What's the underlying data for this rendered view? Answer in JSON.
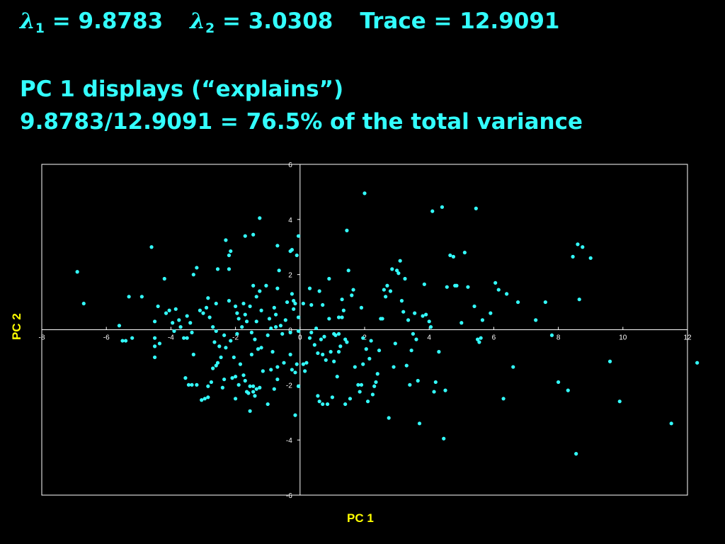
{
  "header": {
    "lambda_symbol": "λ",
    "lambda1_sub": "1",
    "lambda1_value": "= 9.8783",
    "lambda2_sub": "2",
    "lambda2_value": "= 3.0308",
    "trace": "Trace = 12.9091",
    "explain_line1": "PC 1 displays (“explains”)",
    "explain_line2": "9.8783/12.9091 = 76.5% of the total variance"
  },
  "colors": {
    "background": "#000000",
    "text": "#33ffff",
    "axis_title": "#ffff00",
    "points": "#33ffff",
    "plot_bg": "#ffffff"
  },
  "chart_data": {
    "type": "scatter",
    "title": "",
    "xlabel": "PC 1",
    "ylabel": "PC 2",
    "xlim": [
      -8,
      12
    ],
    "ylim": [
      -6,
      6
    ],
    "xticks": [
      -8,
      -6,
      -4,
      -2,
      0,
      2,
      4,
      6,
      8,
      10,
      12
    ],
    "yticks": [
      -6,
      -4,
      -2,
      0,
      2,
      4,
      6
    ],
    "grid": false,
    "series": [
      {
        "points": [
          [
            -6.9,
            2.1
          ],
          [
            -6.7,
            0.95
          ],
          [
            -5.6,
            0.15
          ],
          [
            -5.5,
            -0.4
          ],
          [
            -5.3,
            1.2
          ],
          [
            -5.2,
            -0.3
          ],
          [
            -5.4,
            -0.4
          ],
          [
            -4.9,
            1.2
          ],
          [
            -4.6,
            3.0
          ],
          [
            -4.5,
            0.3
          ],
          [
            -4.4,
            0.85
          ],
          [
            -4.5,
            -0.3
          ],
          [
            -4.5,
            -0.6
          ],
          [
            -4.5,
            -1.0
          ],
          [
            -4.35,
            -0.5
          ],
          [
            -4.2,
            1.85
          ],
          [
            -4.15,
            0.6
          ],
          [
            -4.05,
            0.7
          ],
          [
            -3.95,
            0.25
          ],
          [
            -3.85,
            0.75
          ],
          [
            -3.9,
            -0.05
          ],
          [
            -3.75,
            0.35
          ],
          [
            -3.7,
            0.1
          ],
          [
            -3.6,
            -0.3
          ],
          [
            -3.5,
            0.5
          ],
          [
            -3.4,
            0.25
          ],
          [
            -3.3,
            2.0
          ],
          [
            -3.2,
            2.25
          ],
          [
            -3.1,
            0.7
          ],
          [
            -3.0,
            0.6
          ],
          [
            -3.35,
            -0.1
          ],
          [
            -3.5,
            -0.3
          ],
          [
            -3.3,
            -0.9
          ],
          [
            -2.9,
            0.8
          ],
          [
            -2.85,
            1.15
          ],
          [
            -2.8,
            0.45
          ],
          [
            -2.7,
            0.1
          ],
          [
            -2.6,
            -0.05
          ],
          [
            -2.65,
            -0.45
          ],
          [
            -2.5,
            -0.6
          ],
          [
            -2.6,
            0.95
          ],
          [
            -2.55,
            2.2
          ],
          [
            -2.6,
            -1.3
          ],
          [
            -2.45,
            -1.0
          ],
          [
            -2.35,
            -0.2
          ],
          [
            -2.3,
            -0.65
          ],
          [
            -2.2,
            1.05
          ],
          [
            -2.15,
            -0.4
          ],
          [
            -2.05,
            -1.0
          ],
          [
            -2.3,
            3.25
          ],
          [
            -2.2,
            2.7
          ],
          [
            -2.15,
            2.85
          ],
          [
            -2.2,
            2.2
          ],
          [
            -2.0,
            0.85
          ],
          [
            -1.95,
            0.6
          ],
          [
            -1.9,
            0.4
          ],
          [
            -1.95,
            -0.15
          ],
          [
            -2.0,
            -1.7
          ],
          [
            -1.9,
            -2.0
          ],
          [
            -2.0,
            -2.5
          ],
          [
            -2.1,
            -1.75
          ],
          [
            -2.35,
            -1.8
          ],
          [
            -2.4,
            -2.1
          ],
          [
            -2.55,
            -1.2
          ],
          [
            -2.7,
            -1.4
          ],
          [
            -2.75,
            -1.9
          ],
          [
            -2.85,
            -2.05
          ],
          [
            -2.85,
            -2.45
          ],
          [
            -2.95,
            -2.5
          ],
          [
            -3.05,
            -2.55
          ],
          [
            -3.2,
            -2.0
          ],
          [
            -3.35,
            -2.0
          ],
          [
            -3.45,
            -2.0
          ],
          [
            -3.55,
            -1.75
          ],
          [
            -1.85,
            -1.25
          ],
          [
            -1.75,
            -1.65
          ],
          [
            -1.7,
            -1.85
          ],
          [
            -1.65,
            -2.25
          ],
          [
            -1.6,
            -2.3
          ],
          [
            -1.55,
            -2.95
          ],
          [
            -1.55,
            -2.05
          ],
          [
            -1.45,
            -2.25
          ],
          [
            -1.8,
            0.1
          ],
          [
            -1.75,
            0.95
          ],
          [
            -1.7,
            0.55
          ],
          [
            -1.65,
            0.3
          ],
          [
            -1.55,
            0.85
          ],
          [
            -1.5,
            -0.1
          ],
          [
            -1.4,
            -0.35
          ],
          [
            -1.3,
            -0.7
          ],
          [
            -1.5,
            -0.9
          ],
          [
            -1.35,
            1.2
          ],
          [
            -1.2,
            0.7
          ],
          [
            -1.45,
            3.45
          ],
          [
            -1.7,
            3.4
          ],
          [
            -1.45,
            1.6
          ],
          [
            -1.25,
            1.4
          ],
          [
            -1.2,
            -0.65
          ],
          [
            -1.35,
            0.3
          ],
          [
            -1.25,
            4.05
          ],
          [
            -1.05,
            1.6
          ],
          [
            -0.95,
            0.4
          ],
          [
            -0.9,
            0.05
          ],
          [
            -1.0,
            -0.2
          ],
          [
            -0.85,
            -0.8
          ],
          [
            -0.9,
            -1.45
          ],
          [
            -1.15,
            -1.5
          ],
          [
            -1.25,
            -2.1
          ],
          [
            -1.35,
            -2.15
          ],
          [
            -1.45,
            -2.05
          ],
          [
            -1.4,
            -2.4
          ],
          [
            -1.0,
            -2.7
          ],
          [
            -0.8,
            -2.15
          ],
          [
            -0.75,
            0.1
          ],
          [
            -0.8,
            0.8
          ],
          [
            -0.75,
            0.55
          ],
          [
            -0.7,
            1.5
          ],
          [
            -0.65,
            2.15
          ],
          [
            -0.6,
            0.15
          ],
          [
            -0.55,
            -0.15
          ],
          [
            -0.5,
            -1.2
          ],
          [
            -0.45,
            0.35
          ],
          [
            -0.4,
            1.0
          ],
          [
            -0.3,
            -0.1
          ],
          [
            -0.3,
            -0.9
          ],
          [
            -0.25,
            -1.45
          ],
          [
            -0.15,
            -1.55
          ],
          [
            -0.7,
            -1.35
          ],
          [
            -0.7,
            -1.8
          ],
          [
            -0.7,
            3.05
          ],
          [
            -0.3,
            2.85
          ],
          [
            -0.25,
            1.3
          ],
          [
            -0.2,
            0.75
          ],
          [
            -0.15,
            0.95
          ],
          [
            -0.1,
            2.7
          ],
          [
            -0.05,
            3.4
          ],
          [
            -0.05,
            -0.05
          ],
          [
            -0.1,
            -1.25
          ],
          [
            -0.05,
            -2.05
          ],
          [
            -0.15,
            -3.1
          ],
          [
            -0.2,
            1.05
          ],
          [
            -0.25,
            2.9
          ],
          [
            -0.05,
            0.45
          ],
          [
            0.1,
            0.95
          ],
          [
            0.1,
            -1.25
          ],
          [
            0.15,
            -1.5
          ],
          [
            0.2,
            -1.2
          ],
          [
            0.3,
            -0.3
          ],
          [
            0.3,
            1.5
          ],
          [
            0.35,
            0.9
          ],
          [
            0.45,
            -0.55
          ],
          [
            0.5,
            0.05
          ],
          [
            0.55,
            -0.85
          ],
          [
            0.6,
            1.4
          ],
          [
            0.35,
            -0.1
          ],
          [
            0.7,
            0.9
          ],
          [
            0.7,
            -0.9
          ],
          [
            0.75,
            -0.25
          ],
          [
            0.55,
            -2.4
          ],
          [
            0.6,
            -2.6
          ],
          [
            0.7,
            -2.7
          ],
          [
            0.85,
            -2.7
          ],
          [
            0.65,
            -0.35
          ],
          [
            0.8,
            -1.1
          ],
          [
            0.9,
            1.85
          ],
          [
            0.9,
            0.4
          ],
          [
            0.95,
            -0.8
          ],
          [
            1.05,
            -1.15
          ],
          [
            1.0,
            -2.45
          ],
          [
            1.05,
            -0.15
          ],
          [
            1.1,
            -0.2
          ],
          [
            1.15,
            -1.7
          ],
          [
            1.2,
            -0.8
          ],
          [
            1.2,
            -0.15
          ],
          [
            1.2,
            0.45
          ],
          [
            1.25,
            -0.6
          ],
          [
            1.3,
            0.45
          ],
          [
            1.3,
            1.1
          ],
          [
            1.35,
            0.7
          ],
          [
            1.4,
            -0.35
          ],
          [
            1.4,
            -2.7
          ],
          [
            1.45,
            3.6
          ],
          [
            1.45,
            -0.45
          ],
          [
            1.5,
            2.15
          ],
          [
            1.55,
            -2.5
          ],
          [
            1.6,
            1.25
          ],
          [
            1.65,
            1.45
          ],
          [
            1.7,
            -1.35
          ],
          [
            1.8,
            -2.0
          ],
          [
            1.85,
            -2.25
          ],
          [
            1.9,
            0.8
          ],
          [
            1.9,
            -2.0
          ],
          [
            1.95,
            -0.3
          ],
          [
            1.95,
            -1.25
          ],
          [
            2.0,
            4.95
          ],
          [
            2.05,
            -0.7
          ],
          [
            2.1,
            -2.6
          ],
          [
            2.15,
            -1.05
          ],
          [
            2.2,
            -0.4
          ],
          [
            2.25,
            -2.35
          ],
          [
            2.3,
            -2.05
          ],
          [
            2.35,
            -1.9
          ],
          [
            2.4,
            -1.6
          ],
          [
            2.45,
            -0.75
          ],
          [
            2.5,
            0.4
          ],
          [
            2.55,
            0.4
          ],
          [
            2.6,
            1.45
          ],
          [
            2.65,
            1.2
          ],
          [
            2.7,
            1.6
          ],
          [
            2.75,
            -3.2
          ],
          [
            2.8,
            1.4
          ],
          [
            2.85,
            2.2
          ],
          [
            2.9,
            -1.35
          ],
          [
            2.95,
            -0.5
          ],
          [
            3.0,
            2.15
          ],
          [
            3.05,
            2.05
          ],
          [
            3.1,
            2.5
          ],
          [
            3.15,
            1.05
          ],
          [
            3.2,
            0.65
          ],
          [
            3.25,
            1.85
          ],
          [
            3.3,
            -1.3
          ],
          [
            3.35,
            0.35
          ],
          [
            3.4,
            -2.0
          ],
          [
            3.45,
            -0.75
          ],
          [
            3.5,
            -0.15
          ],
          [
            3.55,
            0.6
          ],
          [
            3.6,
            -0.35
          ],
          [
            3.65,
            -1.85
          ],
          [
            3.7,
            -3.4
          ],
          [
            3.8,
            0.5
          ],
          [
            3.85,
            1.65
          ],
          [
            3.9,
            0.55
          ],
          [
            4.0,
            0.3
          ],
          [
            4.05,
            0.1
          ],
          [
            4.1,
            4.3
          ],
          [
            4.15,
            -2.25
          ],
          [
            4.2,
            -1.9
          ],
          [
            4.3,
            -0.8
          ],
          [
            4.4,
            4.45
          ],
          [
            4.45,
            -3.95
          ],
          [
            4.5,
            -2.2
          ],
          [
            4.55,
            1.55
          ],
          [
            4.65,
            2.7
          ],
          [
            4.75,
            2.65
          ],
          [
            4.8,
            1.6
          ],
          [
            4.85,
            1.6
          ],
          [
            5.0,
            0.25
          ],
          [
            5.1,
            2.8
          ],
          [
            5.2,
            1.55
          ],
          [
            5.4,
            0.85
          ],
          [
            5.45,
            4.4
          ],
          [
            5.5,
            -0.35
          ],
          [
            5.55,
            -0.45
          ],
          [
            5.6,
            -0.3
          ],
          [
            5.65,
            0.35
          ],
          [
            5.9,
            0.6
          ],
          [
            6.05,
            1.7
          ],
          [
            6.15,
            1.45
          ],
          [
            6.3,
            -2.5
          ],
          [
            6.4,
            1.3
          ],
          [
            6.6,
            -1.35
          ],
          [
            6.75,
            1.0
          ],
          [
            7.3,
            0.35
          ],
          [
            7.6,
            1.0
          ],
          [
            7.8,
            -0.2
          ],
          [
            8.0,
            -1.9
          ],
          [
            8.3,
            -2.2
          ],
          [
            8.45,
            2.65
          ],
          [
            8.6,
            3.1
          ],
          [
            8.75,
            3.0
          ],
          [
            8.65,
            1.1
          ],
          [
            9.0,
            2.6
          ],
          [
            8.55,
            -4.5
          ],
          [
            9.6,
            -1.15
          ],
          [
            9.9,
            -2.6
          ],
          [
            11.5,
            -3.4
          ],
          [
            12.3,
            -1.2
          ]
        ]
      }
    ]
  }
}
